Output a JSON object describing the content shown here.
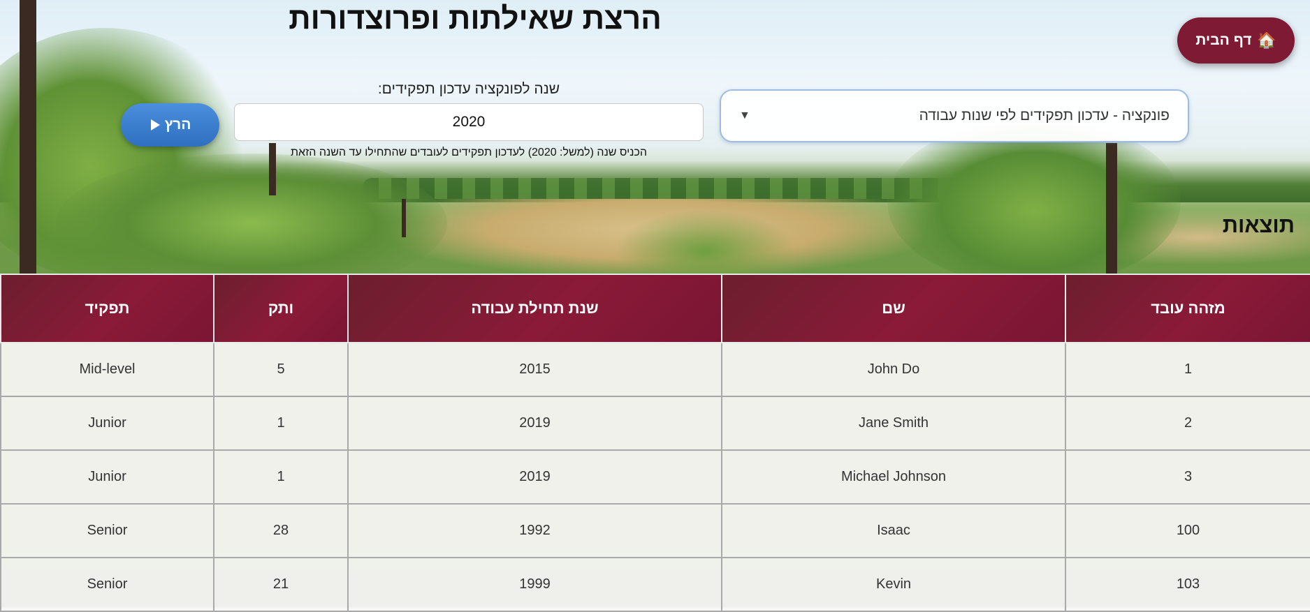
{
  "page": {
    "title": "הרצת שאילתות ופרוצדורות"
  },
  "home_button": {
    "icon": "house-icon",
    "label": "דף הבית"
  },
  "function_select": {
    "selected": "פונקציה - עדכון תפקידים לפי שנות עבודה",
    "arrow_glyph": "▼"
  },
  "year_input": {
    "label": "שנה לפונקציה עדכון תפקידים:",
    "value": "2020",
    "hint": "הכניס שנה (למשל: 2020) לעדכון תפקידים לעובדים שהתחילו עד השנה הזאת"
  },
  "run_button": {
    "icon": "play-icon",
    "label": "הרץ"
  },
  "results": {
    "heading": "תוצאות",
    "columns": [
      "מזהה עובד",
      "שם",
      "שנת תחילת עבודה",
      "ותק",
      "תפקיד"
    ],
    "rows": [
      [
        "1",
        "John Do",
        "2015",
        "5",
        "Mid-level"
      ],
      [
        "2",
        "Jane Smith",
        "2019",
        "1",
        "Junior"
      ],
      [
        "3",
        "Michael Johnson",
        "2019",
        "1",
        "Junior"
      ],
      [
        "100",
        "Isaac",
        "1992",
        "28",
        "Senior"
      ],
      [
        "103",
        "Kevin",
        "1999",
        "21",
        "Senior"
      ]
    ]
  },
  "colors": {
    "header_bg": "#7e1a33",
    "home_button_bg": "#7e1a33",
    "run_button_bg": "#3a7bcf",
    "select_border": "#9fbbe0"
  }
}
